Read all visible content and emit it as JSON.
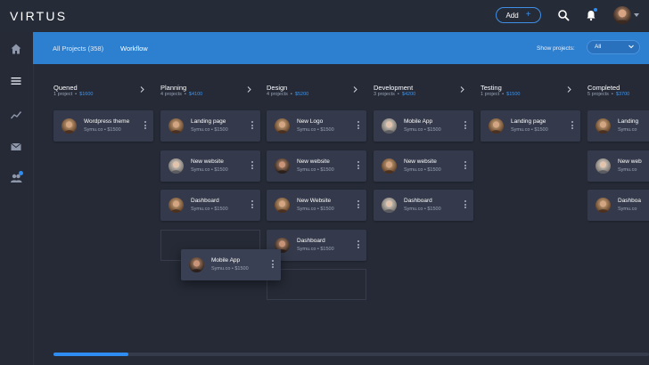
{
  "app": {
    "logo": "VIRTUS"
  },
  "topbar": {
    "add_label": "Add",
    "add_plus": "+"
  },
  "header": {
    "tabs": [
      {
        "label": "All Projects (358)"
      },
      {
        "label": "Workflow"
      }
    ],
    "show_label": "Show projects:",
    "show_value": "All"
  },
  "columns": [
    {
      "title": "Quened",
      "count": "1 project",
      "amount": "$1600",
      "cards": [
        {
          "title": "Wordpress theme",
          "meta": "Symu.co  •  $1500"
        }
      ]
    },
    {
      "title": "Planning",
      "count": "4 projects",
      "amount": "$4100",
      "cards": [
        {
          "title": "Landing page",
          "meta": "Symu.co  •  $1500"
        },
        {
          "title": "New website",
          "meta": "Symu.co  •  $1500"
        },
        {
          "title": "Dashboard",
          "meta": "Symu.co  •  $1500"
        }
      ]
    },
    {
      "title": "Design",
      "count": "4 projects",
      "amount": "$5200",
      "cards": [
        {
          "title": "New Logo",
          "meta": "Symu.co  •  $1500"
        },
        {
          "title": "New website",
          "meta": "Symu.co  •  $1500"
        },
        {
          "title": "New Website",
          "meta": "Symu.co  •  $1500"
        },
        {
          "title": "Dashboard",
          "meta": "Symu.co  •  $1500"
        }
      ]
    },
    {
      "title": "Development",
      "count": "3 projects",
      "amount": "$4200",
      "cards": [
        {
          "title": "Mobile App",
          "meta": "Symu.co  •  $1500"
        },
        {
          "title": "New website",
          "meta": "Symu.co  •  $1500"
        },
        {
          "title": "Dashboard",
          "meta": "Symu.co  •  $1500"
        }
      ]
    },
    {
      "title": "Testing",
      "count": "1 project",
      "amount": "$1500",
      "cards": [
        {
          "title": "Landing page",
          "meta": "Symu.co  •  $1500"
        }
      ]
    },
    {
      "title": "Completed",
      "count": "5 projects",
      "amount": "$3700",
      "cards": [
        {
          "title": "Landing",
          "meta": "Symu.co"
        },
        {
          "title": "New web",
          "meta": "Symu.co"
        },
        {
          "title": "Dashboa",
          "meta": "Symu.co"
        }
      ]
    }
  ],
  "dragged_card": {
    "title": "Mobile App",
    "meta": "Symu.co  •  $1500"
  },
  "colors": {
    "accent": "#2f8cf0",
    "header_blue": "#2d7fd0",
    "card": "#343a4b",
    "background": "#252a36"
  },
  "icons": [
    "home-icon",
    "menu-icon",
    "trend-icon",
    "mail-icon",
    "users-icon",
    "search-icon",
    "bell-icon",
    "chevron-down-icon",
    "chevron-right-icon",
    "more-vertical-icon"
  ]
}
